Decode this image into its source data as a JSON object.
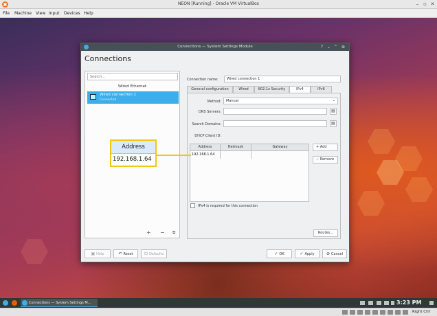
{
  "vbox": {
    "title": "NEON [Running] - Oracle VM VirtualBox",
    "menu": [
      "File",
      "Machine",
      "View",
      "Input",
      "Devices",
      "Help"
    ],
    "host_key": "Right Ctrl"
  },
  "dialog": {
    "title": "Connections — System Settings Module",
    "heading": "Connections",
    "search_placeholder": "Search...",
    "group_label": "Wired Ethernet",
    "connection": {
      "name": "Wired connection 1",
      "status": "Connected"
    },
    "form": {
      "connection_name_label": "Connection name:",
      "connection_name_value": "Wired connection 1",
      "tabs": [
        "General configuration",
        "Wired",
        "802.1x Security",
        "IPv4",
        "IPv6"
      ],
      "active_tab": "IPv4",
      "method_label": "Method:",
      "method_value": "Manual",
      "dns_label": "DNS Servers:",
      "search_domains_label": "Search Domains:",
      "dhcp_label": "DHCP Client ID:",
      "table_headers": [
        "Address",
        "Netmask",
        "Gateway"
      ],
      "table_rows": [
        [
          "192.168.1.64",
          "",
          ""
        ]
      ],
      "add_button": "Add",
      "remove_button": "Remove",
      "required_checkbox_label": "IPv4 is required for this connection",
      "required_checked": false,
      "routes_button": "Routes..."
    },
    "footer": {
      "help": "Help",
      "reset": "Reset",
      "defaults": "Defaults",
      "ok": "OK",
      "apply": "Apply",
      "cancel": "Cancel"
    }
  },
  "callout": {
    "header": "Address",
    "value": "192.168.1.64",
    "border_color": "#f3c711"
  },
  "taskbar": {
    "task_label": "Connections — System Settings M...",
    "clock": "3:23 PM"
  },
  "colors": {
    "accent": "#3daee9",
    "callout": "#f3c711",
    "titlebar": "#475057"
  }
}
